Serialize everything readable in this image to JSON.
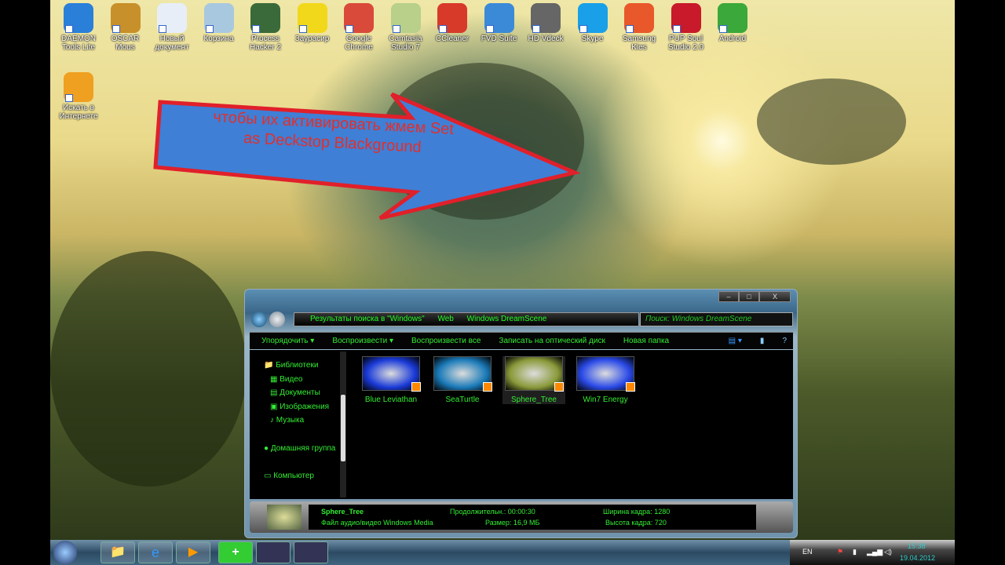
{
  "desktop": {
    "icons": [
      {
        "label": "DAEMON Tools Lite",
        "color": "#2a7fd8"
      },
      {
        "label": "OSCAR Mous",
        "color": "#c8902a"
      },
      {
        "label": "Новый документ",
        "color": "#e8eef8"
      },
      {
        "label": "Корзина",
        "color": "#a8c8e0"
      },
      {
        "label": "Process Hacker 2",
        "color": "#3a6a3a"
      },
      {
        "label": "Заурасир",
        "color": "#f2d81a"
      },
      {
        "label": "Google Chrome",
        "color": "#d94a3a"
      },
      {
        "label": "Camtasia Studio 7",
        "color": "#b8d08a"
      },
      {
        "label": "CCleaner",
        "color": "#d83a2a"
      },
      {
        "label": "FVD Suite",
        "color": "#3a8ad8"
      },
      {
        "label": "HD Vdeck",
        "color": "#666666"
      },
      {
        "label": "Skype",
        "color": "#1aa0e8"
      },
      {
        "label": "Samsung Kies",
        "color": "#e8582a"
      },
      {
        "label": "PUP Soul Studio 2.0",
        "color": "#c81a2a"
      },
      {
        "label": "Android",
        "color": "#3aa83a"
      },
      {
        "label": "Искать в Интернете",
        "color": "#f0a020"
      }
    ]
  },
  "annotation": {
    "text_line1": "чтобы их активировать жмем Set",
    "text_line2": "as Deckstop Blackground",
    "arrow_fill": "#3f7fd6",
    "arrow_stroke": "#e0202a"
  },
  "explorer": {
    "caption": {
      "minimize": "–",
      "maximize": "□",
      "close": "X"
    },
    "address": [
      "Результаты поиска в \"Windows\"",
      "Web",
      "Windows DreamScene"
    ],
    "search_placeholder": "Поиск: Windows DreamScene",
    "toolbar": [
      "Упорядочить ▾",
      "Воспроизвести ▾",
      "Воспроизвести все",
      "Записать на оптический диск",
      "Новая папка"
    ],
    "nav": [
      "Библиотеки",
      "Видео",
      "Документы",
      "Изображения",
      "Музыка",
      "Домашняя группа",
      "Компьютер"
    ],
    "files": [
      {
        "name": "Blue Leviathan",
        "color": "#1a3ad8"
      },
      {
        "name": "SeaTurtle",
        "color": "#1a7ab8"
      },
      {
        "name": "Sphere_Tree",
        "color": "#8a9a3a"
      },
      {
        "name": "Win7 Energy",
        "color": "#2a4ae8"
      }
    ],
    "selected_file": "Sphere_Tree",
    "details": {
      "name": "Sphere_Tree",
      "type": "Файл аудио/видео Windows Media",
      "duration": "Продолжительн.:  00:00:30",
      "size": "Размер:  16,9 МБ",
      "width": "Ширина кадра:  1280",
      "height": "Высота кадра:  720"
    },
    "accent": "#33ee33"
  },
  "taskbar": {
    "language": "EN",
    "time": "15:38",
    "date": "19.04.2012"
  }
}
